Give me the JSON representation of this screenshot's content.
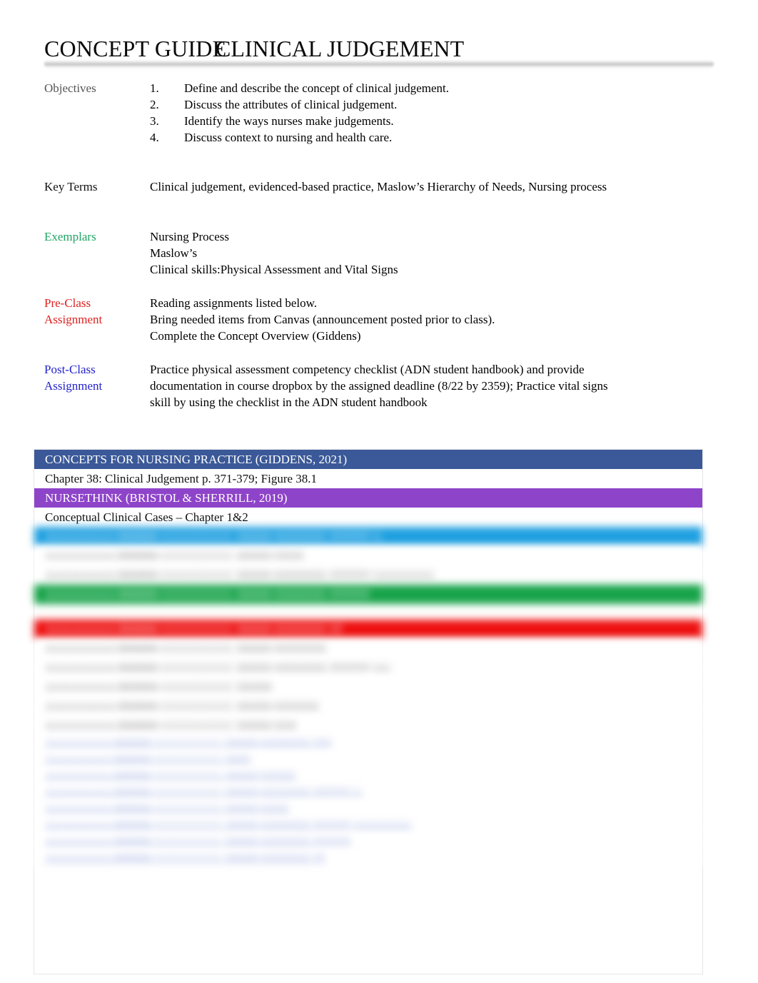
{
  "document": {
    "title_part_a": "CONCEPT GUIDE",
    "title_part_b": "CLINICAL JUDGEMENT"
  },
  "colors": {
    "exemplars_label": "#1FA565",
    "preclass_label": "#E02020",
    "postclass_label": "#2222CC",
    "band_navy": "#3B5998",
    "band_purple": "#8E44C9",
    "band_cyan": "#1FA0E0",
    "band_green": "#17A349",
    "band_red": "#EE1111"
  },
  "sections": {
    "objectives": {
      "label": "Objectives",
      "items": [
        {
          "num": "1.",
          "text": "Define and describe the concept of clinical judgement."
        },
        {
          "num": "2.",
          "text": "Discuss the attributes of clinical judgement."
        },
        {
          "num": "3.",
          "text": "Identify the ways nurses make judgements."
        },
        {
          "num": "4.",
          "text": "Discuss context to nursing and health care."
        }
      ]
    },
    "key_terms": {
      "label": "Key Terms",
      "lines": [
        "Clinical judgement, evidenced-based practice, Maslow’s Hierarchy of Needs, Nursing process"
      ]
    },
    "exemplars": {
      "label": "Exemplars",
      "lines": [
        "Nursing Process",
        "Maslow’s",
        "Clinical skills:Physical Assessment and Vital Signs"
      ]
    },
    "pre_class": {
      "label_line1": "Pre-Class",
      "label_line2": "Assignment",
      "lines": [
        "Reading assignments listed below.",
        "Bring needed items from Canvas (announcement posted prior to class).",
        "Complete the Concept Overview (Giddens)"
      ]
    },
    "post_class": {
      "label_line1": "Post-Class",
      "label_line2": "Assignment",
      "lines": [
        "Practice physical assessment competency checklist (ADN student handbook) and provide",
        "documentation in course dropbox by the assigned deadline (8/22 by 2359); Practice vital signs",
        "skill by using the checklist in the ADN student handbook"
      ]
    }
  },
  "reading_table": {
    "rows": [
      {
        "kind": "band",
        "color": "navy",
        "text": "CONCEPTS FOR NURSING PRACTICE (GIDDENS, 2021)",
        "blurred": false
      },
      {
        "kind": "plain",
        "text": "Chapter 38: Clinical Judgement p. 371-379; Figure 38.1",
        "blurred": false
      },
      {
        "kind": "band",
        "color": "purple",
        "text": "NURSETHINK (BRISTOL & SHERRILL, 2019)",
        "blurred": false
      },
      {
        "kind": "plain",
        "text": "Conceptual Clinical Cases – Chapter 1&2",
        "blurred": false
      },
      {
        "kind": "band",
        "color": "cyan",
        "text": "",
        "blurred": true
      },
      {
        "kind": "plain",
        "text": "",
        "blurred": true
      },
      {
        "kind": "plain",
        "text": "",
        "blurred": true
      },
      {
        "kind": "band",
        "color": "green",
        "text": "",
        "blurred": true
      },
      {
        "kind": "spacer",
        "text": ""
      },
      {
        "kind": "band",
        "color": "red",
        "text": "",
        "blurred": true
      },
      {
        "kind": "plain",
        "text": "",
        "blurred": true
      },
      {
        "kind": "plain",
        "text": "",
        "blurred": true
      },
      {
        "kind": "plain",
        "text": "",
        "blurred": true
      },
      {
        "kind": "plain",
        "text": "",
        "blurred": true
      },
      {
        "kind": "plain",
        "text": "",
        "blurred": true
      },
      {
        "kind": "link",
        "text": "",
        "blurred": true
      },
      {
        "kind": "link",
        "text": "",
        "blurred": true
      },
      {
        "kind": "link",
        "text": "",
        "blurred": true
      },
      {
        "kind": "link",
        "text": "",
        "blurred": true
      },
      {
        "kind": "link",
        "text": "",
        "blurred": true
      },
      {
        "kind": "link",
        "text": "",
        "blurred": true
      },
      {
        "kind": "link",
        "text": "",
        "blurred": true
      },
      {
        "kind": "link",
        "text": "",
        "blurred": true
      }
    ]
  },
  "footer": {
    "left": "",
    "center": "",
    "right": ""
  }
}
